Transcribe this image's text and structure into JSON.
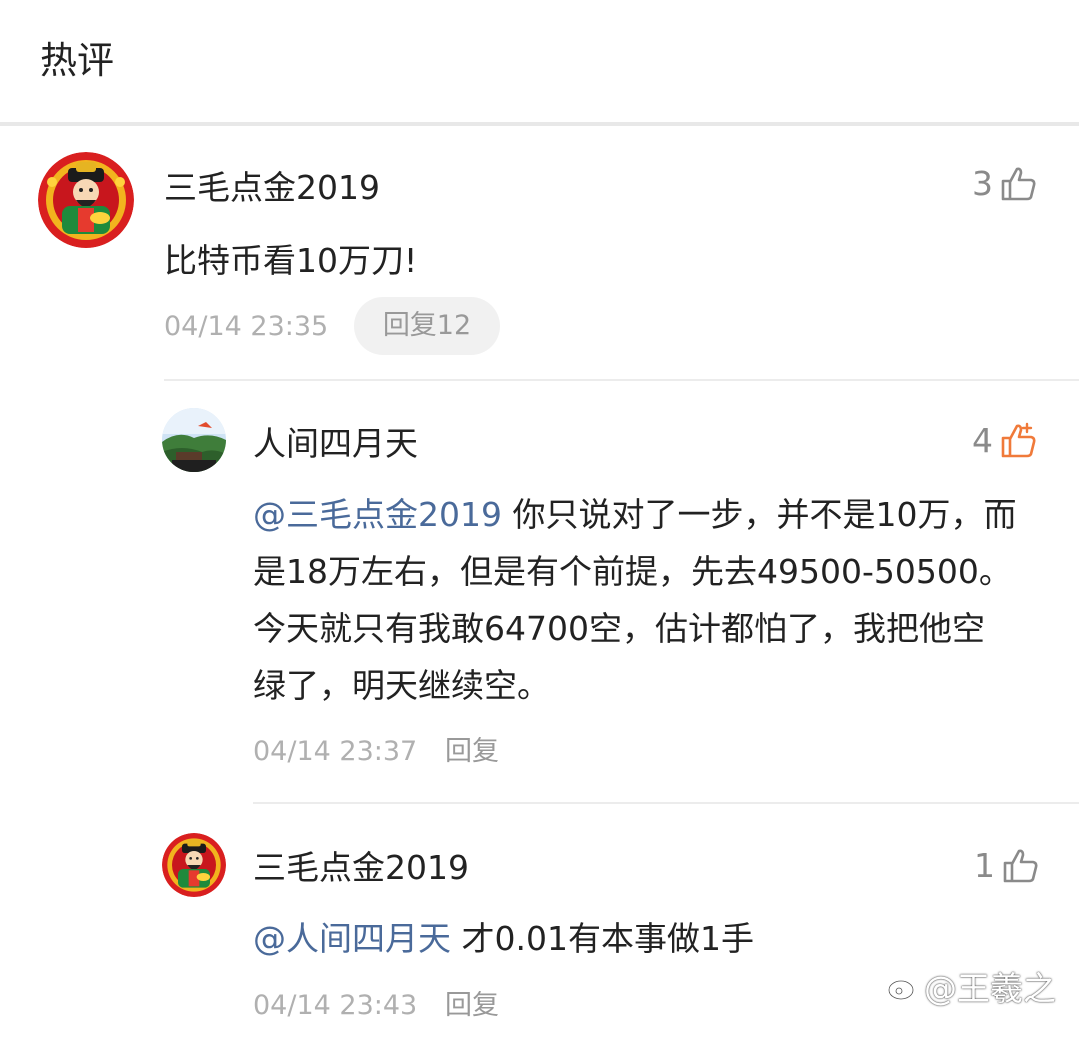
{
  "header": {
    "title": "热评"
  },
  "comments": [
    {
      "username": "三毛点金2019",
      "likes": "3",
      "liked": false,
      "text": "比特币看10万刀!",
      "timestamp": "04/14 23:35",
      "reply_label": "回复12",
      "avatar_icon": "god-of-wealth-avatar"
    }
  ],
  "replies": [
    {
      "username": "人间四月天",
      "likes": "4",
      "liked": true,
      "mention": "@三毛点金2019",
      "text_lines": [
        " 你只说对了一步，并不是10万，而",
        "是18万左右，但是有个前提，先去49500-50500。",
        "今天就只有我敢64700空，估计都怕了，我把他空",
        "绿了，明天继续空。"
      ],
      "timestamp": "04/14 23:37",
      "reply_label": "回复",
      "avatar_icon": "landscape-avatar"
    },
    {
      "username": "三毛点金2019",
      "likes": "1",
      "liked": false,
      "mention": "@人间四月天",
      "text": " 才0.01有本事做1手",
      "timestamp": "04/14 23:43",
      "reply_label": "回复",
      "avatar_icon": "god-of-wealth-avatar"
    }
  ],
  "watermark": {
    "text": "@王羲之",
    "icon": "weibo-logo-icon"
  },
  "colors": {
    "mention": "#4a6a9a",
    "liked": "#f07a3a",
    "like_default": "#8a8a8a",
    "timestamp": "#b0b0b0",
    "pill_bg": "#f1f1f1"
  }
}
